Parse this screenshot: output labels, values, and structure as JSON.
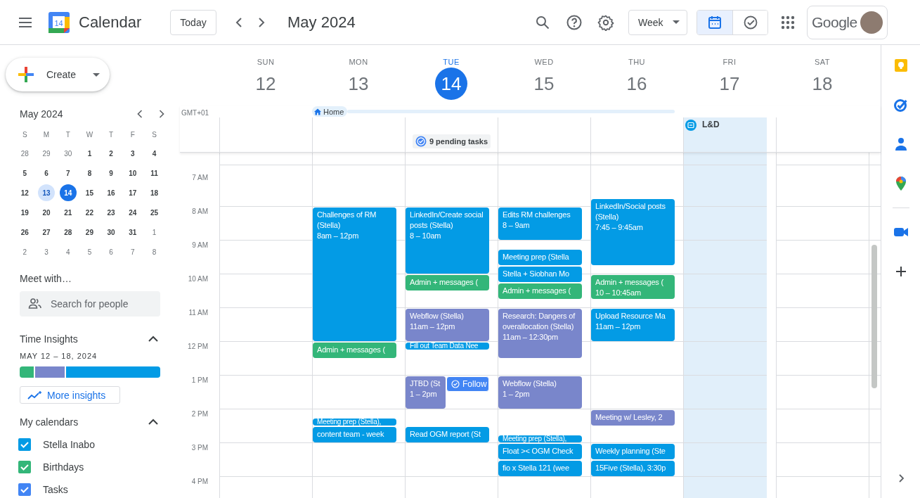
{
  "header": {
    "app_name": "Calendar",
    "logo_date": "14",
    "today_button": "Today",
    "period": "May 2024",
    "view_select": "Week",
    "view_toggle": [
      {
        "kind": "calendar",
        "selected": true
      },
      {
        "kind": "tasks",
        "selected": false
      }
    ],
    "account_brand": "Google"
  },
  "sidebar": {
    "create_button": "Create",
    "mini_calendar": {
      "title": "May 2024",
      "weekdays": [
        "S",
        "M",
        "T",
        "W",
        "T",
        "F",
        "S"
      ],
      "weeks": [
        [
          {
            "label": "28",
            "in_month": false,
            "today": false,
            "selected": false
          },
          {
            "label": "29",
            "in_month": false,
            "today": false,
            "selected": false
          },
          {
            "label": "30",
            "in_month": false,
            "today": false,
            "selected": false
          },
          {
            "label": "1",
            "in_month": true,
            "today": false,
            "selected": false
          },
          {
            "label": "2",
            "in_month": true,
            "today": false,
            "selected": false
          },
          {
            "label": "3",
            "in_month": true,
            "today": false,
            "selected": false
          },
          {
            "label": "4",
            "in_month": true,
            "today": false,
            "selected": false
          }
        ],
        [
          {
            "label": "5",
            "in_month": true,
            "today": false,
            "selected": false
          },
          {
            "label": "6",
            "in_month": true,
            "today": false,
            "selected": false
          },
          {
            "label": "7",
            "in_month": true,
            "today": false,
            "selected": false
          },
          {
            "label": "8",
            "in_month": true,
            "today": false,
            "selected": false
          },
          {
            "label": "9",
            "in_month": true,
            "today": false,
            "selected": false
          },
          {
            "label": "10",
            "in_month": true,
            "today": false,
            "selected": false
          },
          {
            "label": "11",
            "in_month": true,
            "today": false,
            "selected": false
          }
        ],
        [
          {
            "label": "12",
            "in_month": true,
            "today": false,
            "selected": false
          },
          {
            "label": "13",
            "in_month": true,
            "today": false,
            "selected": true
          },
          {
            "label": "14",
            "in_month": true,
            "today": true,
            "selected": false
          },
          {
            "label": "15",
            "in_month": true,
            "today": false,
            "selected": false
          },
          {
            "label": "16",
            "in_month": true,
            "today": false,
            "selected": false
          },
          {
            "label": "17",
            "in_month": true,
            "today": false,
            "selected": false
          },
          {
            "label": "18",
            "in_month": true,
            "today": false,
            "selected": false
          }
        ],
        [
          {
            "label": "19",
            "in_month": true,
            "today": false,
            "selected": false
          },
          {
            "label": "20",
            "in_month": true,
            "today": false,
            "selected": false
          },
          {
            "label": "21",
            "in_month": true,
            "today": false,
            "selected": false
          },
          {
            "label": "22",
            "in_month": true,
            "today": false,
            "selected": false
          },
          {
            "label": "23",
            "in_month": true,
            "today": false,
            "selected": false
          },
          {
            "label": "24",
            "in_month": true,
            "today": false,
            "selected": false
          },
          {
            "label": "25",
            "in_month": true,
            "today": false,
            "selected": false
          }
        ],
        [
          {
            "label": "26",
            "in_month": true,
            "today": false,
            "selected": false
          },
          {
            "label": "27",
            "in_month": true,
            "today": false,
            "selected": false
          },
          {
            "label": "28",
            "in_month": true,
            "today": false,
            "selected": false
          },
          {
            "label": "29",
            "in_month": true,
            "today": false,
            "selected": false
          },
          {
            "label": "30",
            "in_month": true,
            "today": false,
            "selected": false
          },
          {
            "label": "31",
            "in_month": true,
            "today": false,
            "selected": false
          },
          {
            "label": "1",
            "in_month": false,
            "today": false,
            "selected": false
          }
        ],
        [
          {
            "label": "2",
            "in_month": false,
            "today": false,
            "selected": false
          },
          {
            "label": "3",
            "in_month": false,
            "today": false,
            "selected": false
          },
          {
            "label": "4",
            "in_month": false,
            "today": false,
            "selected": false
          },
          {
            "label": "5",
            "in_month": false,
            "today": false,
            "selected": false
          },
          {
            "label": "6",
            "in_month": false,
            "today": false,
            "selected": false
          },
          {
            "label": "7",
            "in_month": false,
            "today": false,
            "selected": false
          },
          {
            "label": "8",
            "in_month": false,
            "today": false,
            "selected": false
          }
        ]
      ]
    },
    "meet_with": {
      "title": "Meet with…",
      "placeholder": "Search for people"
    },
    "time_insights": {
      "title": "Time Insights",
      "expanded": true,
      "range": "MAY 12 – 18, 2024",
      "segments": [
        {
          "color": "#33b679",
          "level": 0.1
        },
        {
          "color": "#7986cb",
          "level": 0.22
        },
        {
          "color": "#039be5",
          "level": 0.68
        }
      ],
      "more_button": "More insights"
    },
    "my_calendars": {
      "title": "My calendars",
      "expanded": true,
      "items": [
        {
          "label": "Stella Inabo",
          "color": "#039be5",
          "checked": true
        },
        {
          "label": "Birthdays",
          "color": "#33b679",
          "checked": true
        },
        {
          "label": "Tasks",
          "color": "#4285f4",
          "checked": true
        }
      ]
    }
  },
  "week": {
    "timezone": "GMT+01",
    "working_location_label": "Home",
    "hours": [
      "7 AM",
      "8 AM",
      "9 AM",
      "10 AM",
      "11 AM",
      "12 PM",
      "1 PM",
      "2 PM",
      "3 PM",
      "4 PM"
    ],
    "days": [
      {
        "weekday": "SUN",
        "date": "12",
        "today": false,
        "working_location": false
      },
      {
        "weekday": "MON",
        "date": "13",
        "today": false,
        "working_location": true,
        "events": [
          {
            "kind": "event",
            "title": "Challenges of RM (Stella)",
            "time": "8am – 12pm",
            "color": "#039be5"
          },
          {
            "kind": "event",
            "title": "Admin + messages (",
            "color": "#33b679"
          },
          {
            "kind": "event",
            "title": "Meeting prep (Stella),",
            "color": "#039be5"
          },
          {
            "kind": "event",
            "title": "content team - week",
            "color": "#039be5"
          }
        ]
      },
      {
        "weekday": "TUE",
        "date": "14",
        "today": true,
        "working_location": true,
        "tasks_chip": "9 pending tasks",
        "events": [
          {
            "kind": "event",
            "title": "LinkedIn/Create social posts (Stella)",
            "time": "8 – 10am",
            "color": "#039be5"
          },
          {
            "kind": "event",
            "title": "Admin + messages (",
            "color": "#33b679"
          },
          {
            "kind": "event",
            "title": "Webflow (Stella)",
            "time": "11am – 12pm",
            "color": "#7986cb"
          },
          {
            "kind": "event",
            "title": "Fill out Team Data Nee",
            "color": "#039be5"
          },
          {
            "kind": "event",
            "title": "JTBD (St",
            "time": "1 – 2pm",
            "color": "#7986cb"
          },
          {
            "kind": "task",
            "title": "Follow",
            "color": "#4285f4"
          },
          {
            "kind": "event",
            "title": "Read OGM report (St",
            "color": "#039be5"
          }
        ]
      },
      {
        "weekday": "WED",
        "date": "15",
        "today": false,
        "working_location": true,
        "events": [
          {
            "kind": "event",
            "title": "Edits RM challenges",
            "time": "8 – 9am",
            "color": "#039be5"
          },
          {
            "kind": "event",
            "title": "Meeting prep (Stella",
            "color": "#039be5"
          },
          {
            "kind": "event",
            "title": "Stella + Siobhan Mo",
            "color": "#039be5"
          },
          {
            "kind": "event",
            "title": "Admin + messages (",
            "color": "#33b679"
          },
          {
            "kind": "event",
            "title": "Research: Dangers of overallocation (Stella)",
            "time": "11am – 12:30pm",
            "color": "#7986cb"
          },
          {
            "kind": "event",
            "title": "Webflow (Stella)",
            "time": "1 – 2pm",
            "color": "#7986cb"
          },
          {
            "kind": "event",
            "title": "Meeting prep (Stella),",
            "color": "#039be5"
          },
          {
            "kind": "event",
            "title": "Float >< OGM Check",
            "color": "#039be5"
          },
          {
            "kind": "event",
            "title": "fio x Stella 121 (wee",
            "color": "#039be5"
          }
        ]
      },
      {
        "weekday": "THU",
        "date": "16",
        "today": false,
        "working_location": true,
        "events": [
          {
            "kind": "event",
            "title": "LinkedIn/Social posts (Stella)",
            "time": "7:45 – 9:45am",
            "color": "#039be5"
          },
          {
            "kind": "event",
            "title": "Admin + messages (",
            "time": "10 – 10:45am",
            "color": "#33b679"
          },
          {
            "kind": "event",
            "title": "Upload Resource Ma",
            "time": "11am – 12pm",
            "color": "#039be5"
          },
          {
            "kind": "event",
            "title": "Meeting w/ Lesley, 2",
            "color": "#7986cb"
          },
          {
            "kind": "event",
            "title": "Weekly planning (Ste",
            "color": "#039be5"
          },
          {
            "kind": "event",
            "title": "15Five (Stella), 3:30p",
            "color": "#039be5"
          }
        ]
      },
      {
        "weekday": "FRI",
        "date": "17",
        "today": false,
        "working_location": false,
        "all_day_block": "L&D"
      },
      {
        "weekday": "SAT",
        "date": "18",
        "today": false,
        "working_location": false
      }
    ]
  }
}
